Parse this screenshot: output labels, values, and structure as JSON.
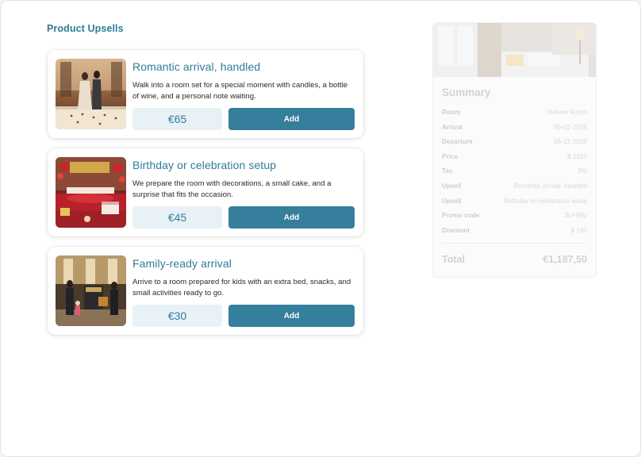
{
  "section": {
    "title": "Product Upsells"
  },
  "upsells": [
    {
      "title": "Romantic arrival, handled",
      "description": "Walk into a room set for a special moment with candles, a bottle of wine, and a personal note waiting.",
      "price": "€65",
      "add_label": "Add"
    },
    {
      "title": "Birthday or celebration setup",
      "description": "We prepare the room with decorations, a small cake, and a surprise that fits the occasion.",
      "price": "€45",
      "add_label": "Add"
    },
    {
      "title": "Family-ready arrival",
      "description": "Arrive to a room prepared for kids with an extra bed, snacks, and small activities ready to go.",
      "price": "€30",
      "add_label": "Add"
    }
  ],
  "summary": {
    "title": "Summary",
    "rows": [
      {
        "label": "Room",
        "value": "Deluxe Room"
      },
      {
        "label": "Arrival",
        "value": "06-02-2026"
      },
      {
        "label": "Departure",
        "value": "06-12-2026"
      },
      {
        "label": "Price",
        "value": "$ 1250"
      },
      {
        "label": "Tax",
        "value": "3%"
      },
      {
        "label": "Upsell",
        "value": "Romantic arrival, handled"
      },
      {
        "label": "Upsell",
        "value": "Birthday or celebration setup"
      },
      {
        "label": "Promo code",
        "value": "3LF98V"
      },
      {
        "label": "Discount",
        "value": "$ 100"
      }
    ],
    "total_label": "Total",
    "total_value": "€1,187,50"
  },
  "colors": {
    "accent": "#2f7c97",
    "button": "#357e9c",
    "price_bg": "#e8f1f6"
  }
}
